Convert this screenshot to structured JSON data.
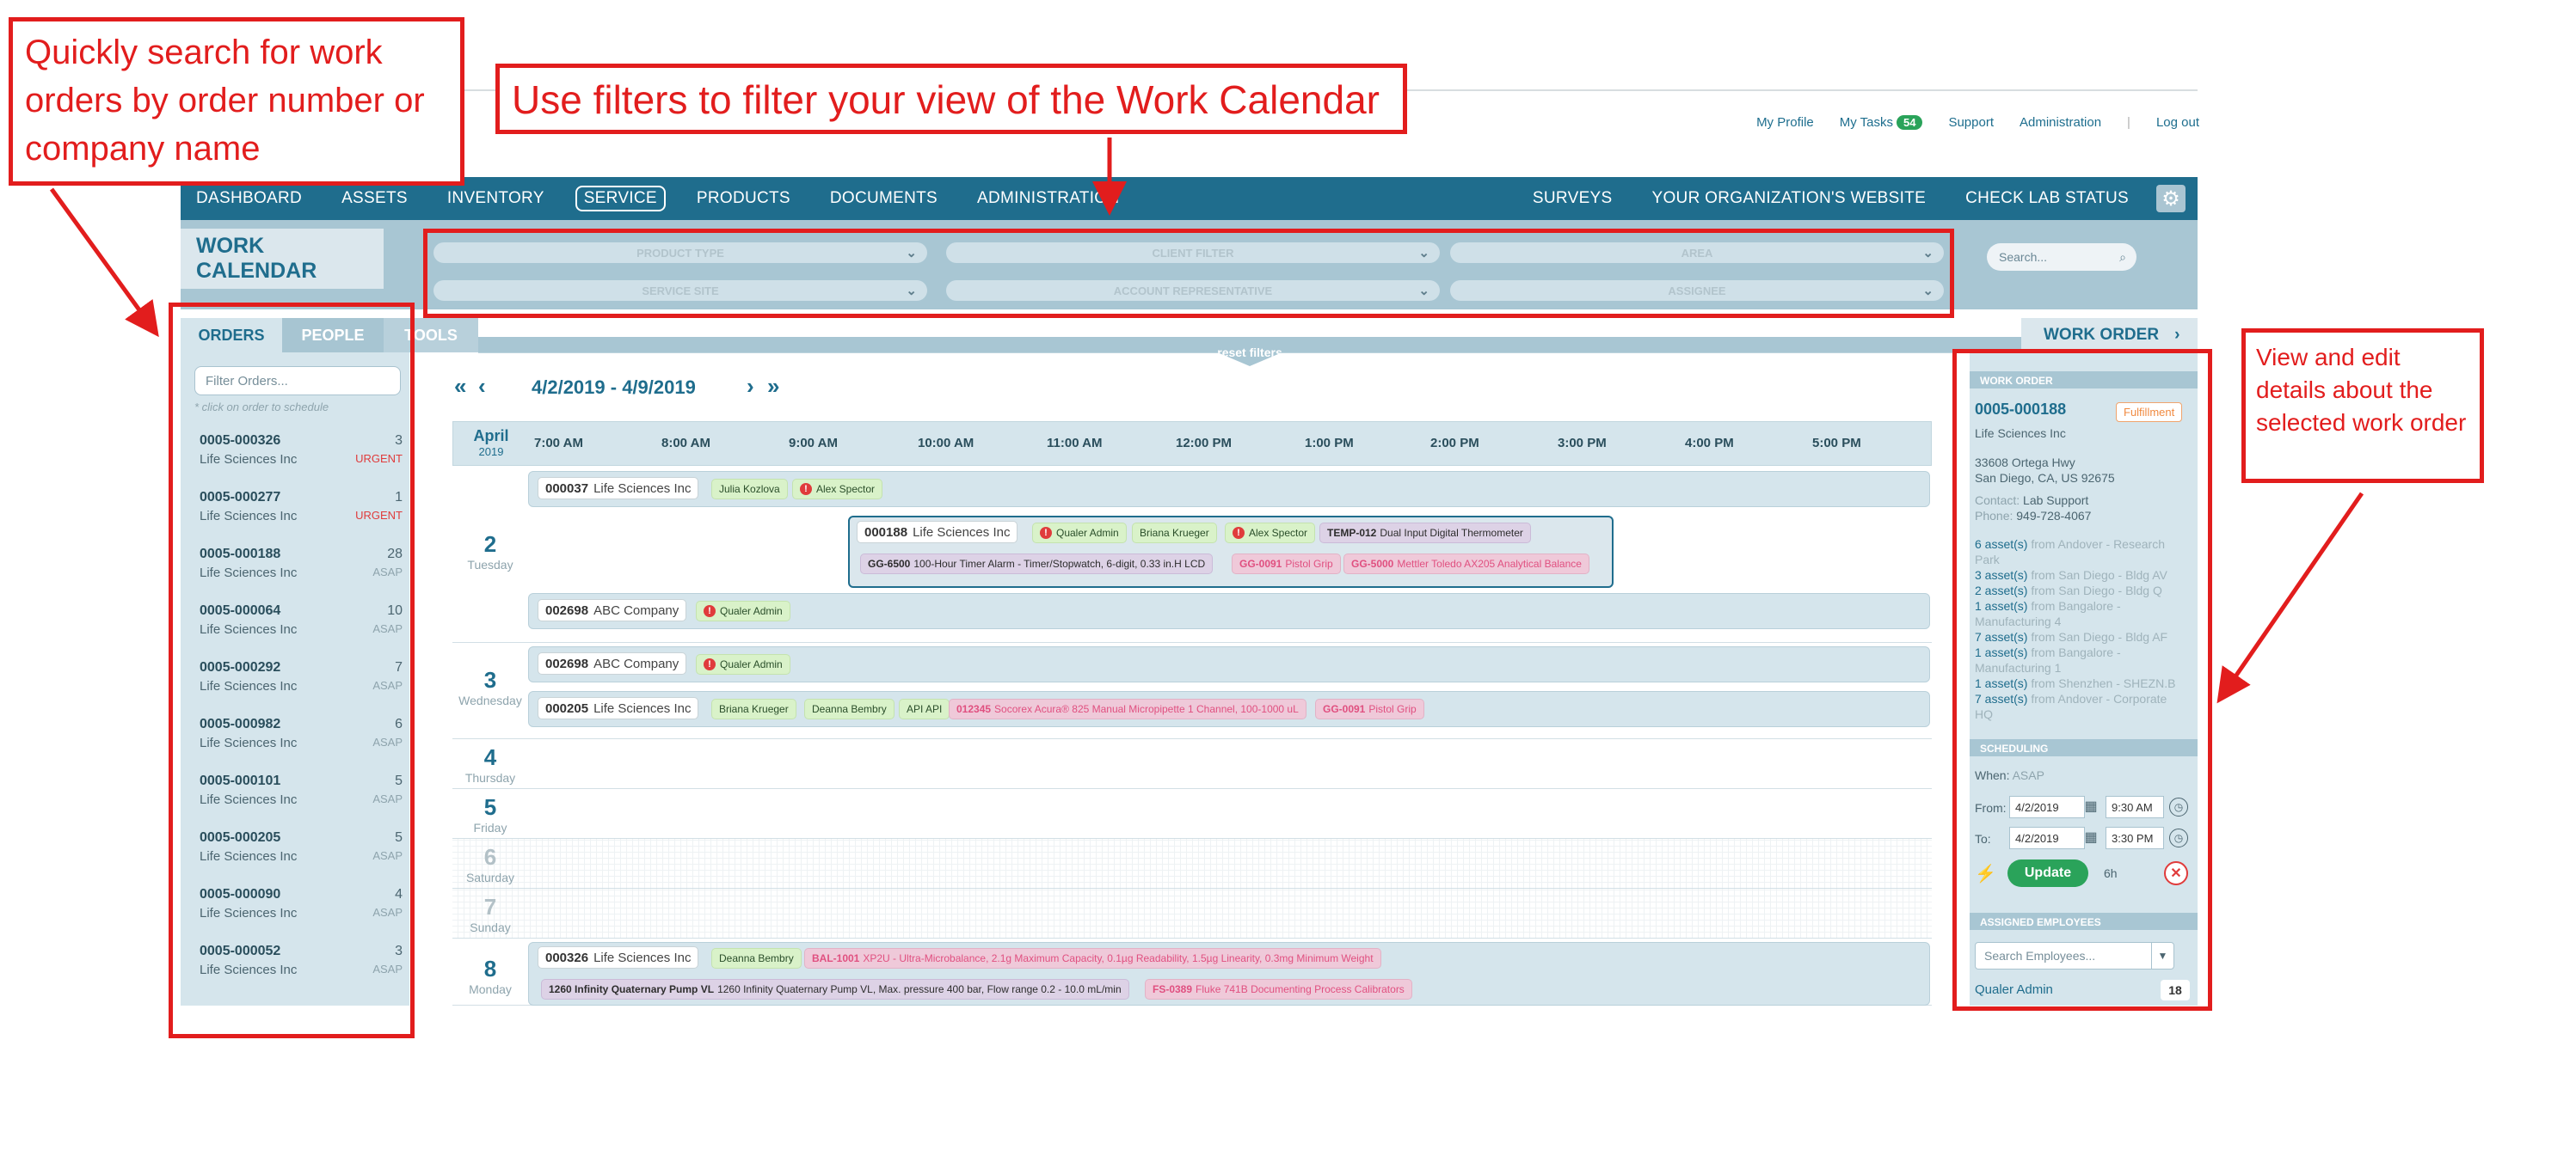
{
  "toplinks": {
    "profile": "My Profile",
    "tasks": "My Tasks",
    "tasks_count": "54",
    "support": "Support",
    "admin": "Administration",
    "sep": "|",
    "logout": "Log out"
  },
  "nav": {
    "items": [
      "DASHBOARD",
      "ASSETS",
      "INVENTORY",
      "SERVICE",
      "PRODUCTS",
      "DOCUMENTS",
      "ADMINISTRATION"
    ],
    "right": [
      "SURVEYS",
      "YOUR ORGANIZATION'S WEBSITE",
      "CHECK LAB STATUS"
    ]
  },
  "page_title": "WORK CALENDAR",
  "filters": [
    "PRODUCT TYPE",
    "CLIENT FILTER",
    "AREA",
    "SERVICE SITE",
    "ACCOUNT REPRESENTATIVE",
    "ASSIGNEE"
  ],
  "search_placeholder": "Search...",
  "tabs": {
    "orders": "ORDERS",
    "people": "PEOPLE",
    "tools": "TOOLS",
    "work_order": "WORK ORDER"
  },
  "reset_filters": "reset filters",
  "orders_panel": {
    "filter_placeholder": "Filter Orders...",
    "note": "* click on order to schedule",
    "items": [
      {
        "num": "0005-000326",
        "company": "Life Sciences Inc",
        "count": "3",
        "priority": "URGENT"
      },
      {
        "num": "0005-000277",
        "company": "Life Sciences Inc",
        "count": "1",
        "priority": "URGENT"
      },
      {
        "num": "0005-000188",
        "company": "Life Sciences Inc",
        "count": "28",
        "priority": "ASAP"
      },
      {
        "num": "0005-000064",
        "company": "Life Sciences Inc",
        "count": "10",
        "priority": "ASAP"
      },
      {
        "num": "0005-000292",
        "company": "Life Sciences Inc",
        "count": "7",
        "priority": "ASAP"
      },
      {
        "num": "0005-000982",
        "company": "Life Sciences Inc",
        "count": "6",
        "priority": "ASAP"
      },
      {
        "num": "0005-000101",
        "company": "Life Sciences Inc",
        "count": "5",
        "priority": "ASAP"
      },
      {
        "num": "0005-000205",
        "company": "Life Sciences Inc",
        "count": "5",
        "priority": "ASAP"
      },
      {
        "num": "0005-000090",
        "company": "Life Sciences Inc",
        "count": "4",
        "priority": "ASAP"
      },
      {
        "num": "0005-000052",
        "company": "Life Sciences Inc",
        "count": "3",
        "priority": "ASAP"
      }
    ]
  },
  "calendar": {
    "range": "4/2/2019 - 4/9/2019",
    "month": "April",
    "year": "2019",
    "hours": [
      "7:00 AM",
      "8:00 AM",
      "9:00 AM",
      "10:00 AM",
      "11:00 AM",
      "12:00 PM",
      "1:00 PM",
      "2:00 PM",
      "3:00 PM",
      "4:00 PM",
      "5:00 PM"
    ],
    "days": [
      {
        "d": "2",
        "n": "Tuesday"
      },
      {
        "d": "3",
        "n": "Wednesday"
      },
      {
        "d": "4",
        "n": "Thursday"
      },
      {
        "d": "5",
        "n": "Friday"
      },
      {
        "d": "6",
        "n": "Saturday"
      },
      {
        "d": "7",
        "n": "Sunday"
      },
      {
        "d": "8",
        "n": "Monday"
      }
    ],
    "events": {
      "e1": {
        "num": "000037",
        "co": "Life Sciences Inc",
        "p1": "Julia Kozlova",
        "p2": "Alex Spector"
      },
      "e2": {
        "num": "000188",
        "co": "Life Sciences Inc",
        "p1": "Qualer Admin",
        "p2": "Briana Krueger",
        "p3": "Alex Spector",
        "a1b": "TEMP-012",
        "a1": "Dual Input Digital Thermometer",
        "a2b": "GG-6500",
        "a2": "100-Hour Timer Alarm - Timer/Stopwatch, 6-digit, 0.33 in.H LCD",
        "a3b": "GG-0091",
        "a3": "Pistol Grip",
        "a4b": "GG-5000",
        "a4": "Mettler Toledo AX205 Analytical Balance"
      },
      "e3": {
        "num": "002698",
        "co": "ABC Company",
        "p1": "Qualer Admin"
      },
      "e4": {
        "num": "002698",
        "co": "ABC Company",
        "p1": "Qualer Admin"
      },
      "e5": {
        "num": "000205",
        "co": "Life Sciences Inc",
        "p1": "Briana Krueger",
        "p2": "Deanna Bembry",
        "p3": "API API",
        "a1b": "012345",
        "a1": "Socorex Acura® 825 Manual Micropipette 1 Channel, 100-1000 uL",
        "a2b": "GG-0091",
        "a2": "Pistol Grip"
      },
      "e6": {
        "num": "000326",
        "co": "Life Sciences Inc",
        "p1": "Deanna Bembry",
        "a1b": "BAL-1001",
        "a1": "XP2U - Ultra-Microbalance, 2.1g Maximum Capacity, 0.1µg Readability, 1.5µg Linearity, 0.3mg Minimum Weight",
        "a2b": "1260 Infinity Quaternary Pump VL",
        "a2": "1260 Infinity Quaternary Pump VL, Max. pressure 400 bar, Flow range 0.2 - 10.0 mL/min",
        "a3b": "FS-0389",
        "a3": "Fluke 741B Documenting Process Calibrators"
      }
    }
  },
  "detail": {
    "section_wo": "WORK ORDER",
    "num": "0005-000188",
    "badge": "Fulfillment",
    "company": "Life Sciences Inc",
    "addr1": "33608 Ortega Hwy",
    "addr2": "San Diego, CA, US 92675",
    "contact_lbl": "Contact:",
    "contact": "Lab Support",
    "phone_lbl": "Phone:",
    "phone": "949-728-4067",
    "assets": [
      {
        "a": "6 asset(s)",
        "f": "from Andover - Research Park"
      },
      {
        "a": "3 asset(s)",
        "f": "from San Diego - Bldg AV"
      },
      {
        "a": "2 asset(s)",
        "f": "from San Diego - Bldg Q"
      },
      {
        "a": "1 asset(s)",
        "f": "from Bangalore - Manufacturing 4"
      },
      {
        "a": "7 asset(s)",
        "f": "from San Diego - Bldg AF"
      },
      {
        "a": "1 asset(s)",
        "f": "from Bangalore - Manufacturing 1"
      },
      {
        "a": "1 asset(s)",
        "f": "from Shenzhen - SHEZN.B"
      },
      {
        "a": "7 asset(s)",
        "f": "from Andover - Corporate HQ"
      }
    ],
    "section_sched": "SCHEDULING",
    "when_lbl": "When:",
    "when": "ASAP",
    "from_lbl": "From:",
    "to_lbl": "To:",
    "from_date": "4/2/2019",
    "from_time": "9:30 AM",
    "to_date": "4/2/2019",
    "to_time": "3:30 PM",
    "update": "Update",
    "duration": "6h",
    "section_emp": "ASSIGNED EMPLOYEES",
    "emp_placeholder": "Search Employees...",
    "emp_name": "Qualer Admin",
    "emp_count": "18"
  },
  "callouts": {
    "search": "Quickly search for work orders by order number or company name",
    "filters": "Use filters to filter your view of the Work Calendar",
    "details": "View and edit details about the selected work order"
  }
}
